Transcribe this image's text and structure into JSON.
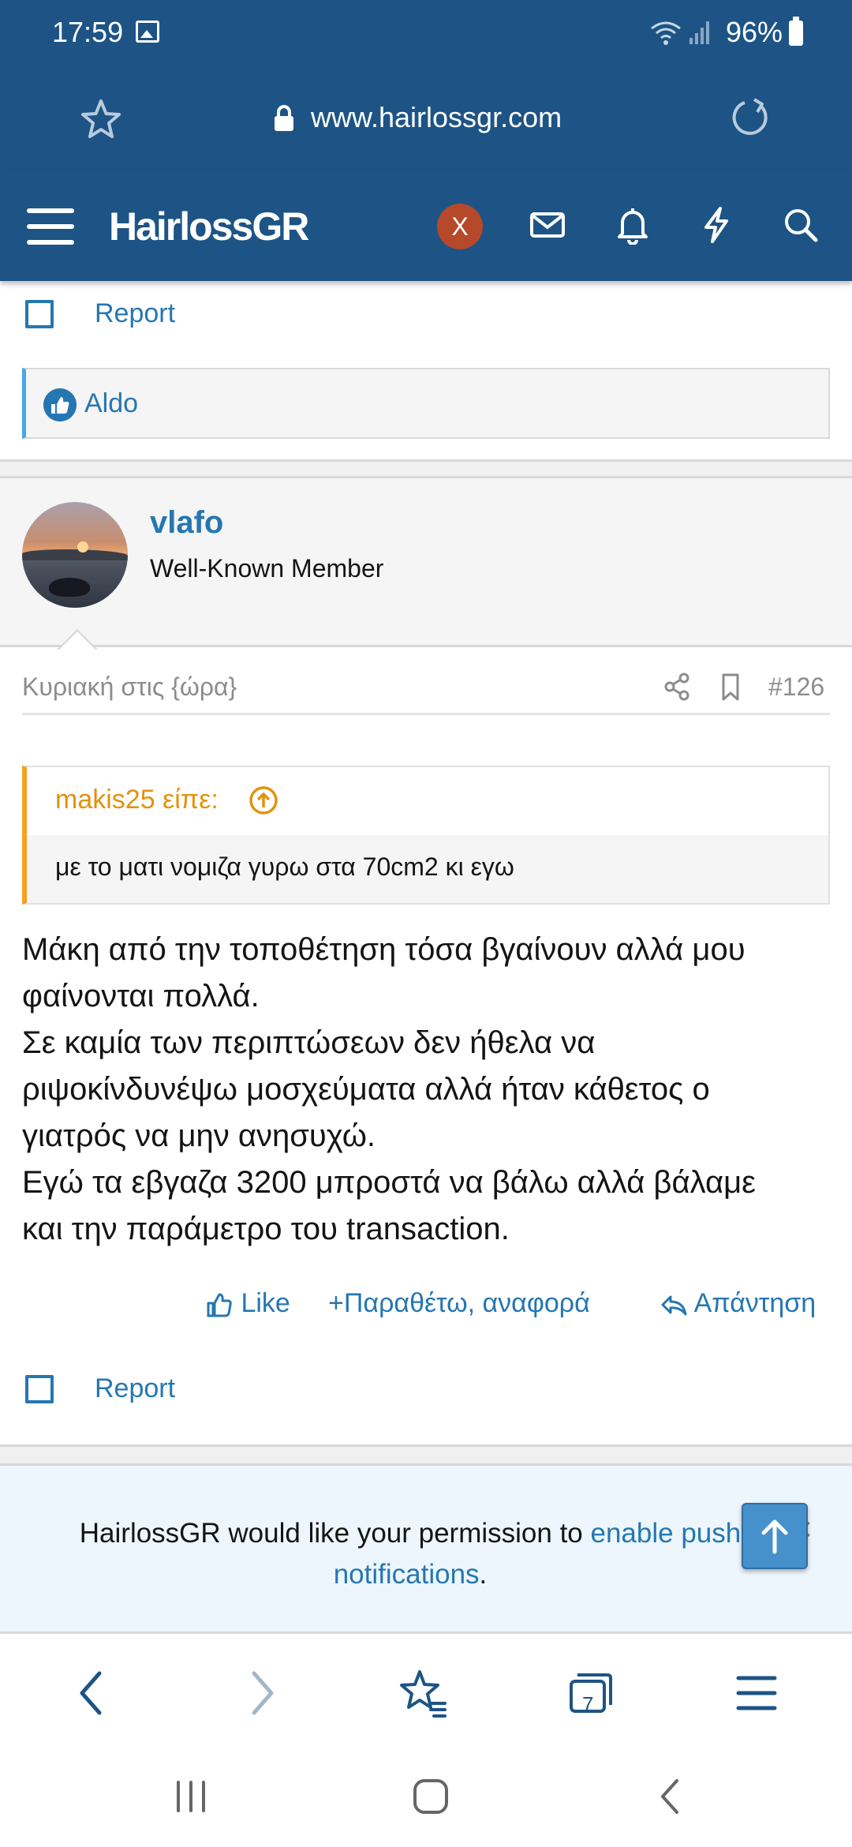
{
  "status_bar": {
    "time": "17:59",
    "battery": "96%"
  },
  "browser": {
    "url": "www.hairlossgr.com",
    "tab_count": "7"
  },
  "site": {
    "logo": "HairlossGR",
    "avatar_letter": "X"
  },
  "previous_post": {
    "report_label": "Report",
    "reaction_user": "Aldo"
  },
  "post": {
    "author": "vlafo",
    "author_title": "Well-Known Member",
    "date": "Κυριακή στις {ώρα}",
    "number": "#126",
    "quote": {
      "author": "makis25 είπε:",
      "text": "με το ματι νομιζα γυρω στα 70cm2 κι εγω"
    },
    "body_lines": [
      "Μάκη από την τοποθέτηση τόσα βγαίνουν αλλά μου",
      "φαίνονται πολλά.",
      "Σε καμία των περιπτώσεων δεν ήθελα να",
      "ριψοκίνδυνέψω μοσχεύματα αλλά ήταν κάθετος ο",
      "γιατρός να μην ανησυχώ.",
      "Εγώ τα εβγαζα 3200 μπροστά να βάλω αλλά βάλαμε",
      "και την παράμετρο του transaction."
    ],
    "actions": {
      "like": "Like",
      "quote": "Παραθέτω, αναφορά",
      "reply": "Απάντηση"
    },
    "report_label": "Report"
  },
  "push_banner": {
    "text_before": "HairlossGR would like your permission to ",
    "link_line1": "enable push",
    "link_line2": "notifications",
    "text_after": ".",
    "close": "×"
  },
  "colors": {
    "header": "#1d5485",
    "link": "#2577b1",
    "quote_accent": "#f4a022",
    "banner_bg": "#edf6fd"
  }
}
